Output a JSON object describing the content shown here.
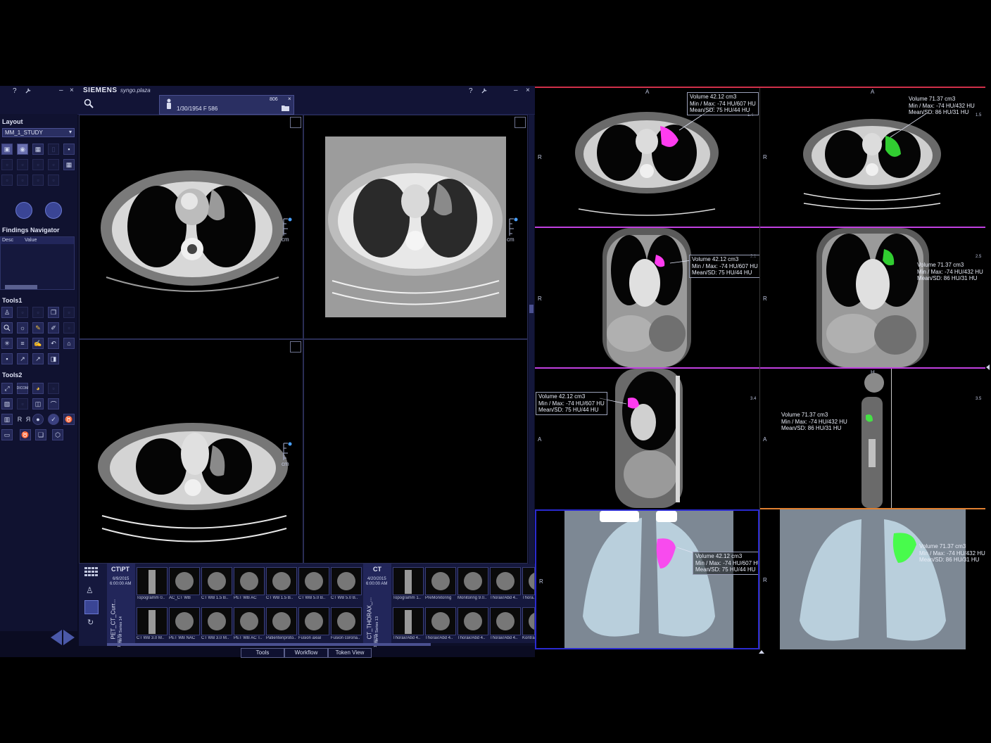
{
  "app": {
    "brand": "SIEMENS",
    "product": "syngo.plaza",
    "help_icon": "?",
    "wrench_icon": "wrench-icon",
    "minimize_label": "–",
    "close_label": "×"
  },
  "patient": {
    "dob_sex_id": "1/30/1954  F  586",
    "count": "806",
    "close_label": "×"
  },
  "left_panel": {
    "layout_title": "Layout",
    "layout_select": "MM_1_STUDY",
    "findings_title": "Findings Navigator",
    "findings_cols": [
      "Desc",
      "Value"
    ],
    "tools1_title": "Tools1",
    "tools2_title": "Tools2",
    "tool_labels": {
      "dicom": "DICOM",
      "r_label": "R",
      "ya_label": "Я"
    }
  },
  "viewports": {
    "ruler_unit": "cm"
  },
  "right_panel": {
    "labels": {
      "a": "A",
      "r": "R",
      "h": "H"
    },
    "pink_stats": {
      "volume": "Volume 42.12 cm3",
      "minmax": "Min / Max: -74 HU/607 HU",
      "meansd": "Mean/SD: 75 HU/44 HU"
    },
    "green_stats": {
      "volume": "Volume 71.37 cm3",
      "minmax": "Min / Max: -74 HU/432 HU",
      "meansd": "Mean/SD: 86 HU/31 HU"
    },
    "slice_numbers": [
      "1.4",
      "1.5",
      "2.1",
      "2.5",
      "3.4",
      "3.5"
    ]
  },
  "studies": [
    {
      "modality": "CT\\PT",
      "date": "6/9/2015",
      "time": "6:00:00 AM",
      "name": "PET_CT_Curr...",
      "series_count": "No of Series 14",
      "id": "109170",
      "top_thumbs": [
        "Topogramm 0..",
        "AC_CT WB",
        "CT WB 1.5 B..",
        "PET WB AC",
        "CT WB 1.5 B..",
        "CT WB 5.0 B..",
        "CT WB 5.0 B.."
      ],
      "bottom_thumbs": [
        "CT WB 3.0 M..",
        "PET WB NAC",
        "CT WB 3.0 M..",
        "PET WB AC T..",
        "Patientenproto..",
        "Fusion axial",
        "Fusion corona.."
      ]
    },
    {
      "modality": "CT",
      "date": "4/20/2015",
      "time": "6:00:00 AM",
      "name": "CT_THORAX_...",
      "series_count": "No of Series 13",
      "id": "109155",
      "top_thumbs": [
        "Topogramm 1..",
        "PreMonitoring",
        "Monitoring 9.0..",
        "Thorax/Abd 4..",
        "Thora.."
      ],
      "bottom_thumbs": [
        "Thorax/Abd 4..",
        "Thorax/Abd 4..",
        "Thorax/Abd 4..",
        "Thorax/Abd 4..",
        "Kontra.."
      ]
    }
  ],
  "bottom_tabs": [
    "Tools",
    "Workflow",
    "Token View"
  ],
  "colors": {
    "accent_pink": "#ff3cf0",
    "accent_green": "#3cff3c",
    "row1_border": "#d0304a",
    "row2_border": "#c040e0",
    "row4_border": "#e08030",
    "panel_bg": "#101230"
  }
}
